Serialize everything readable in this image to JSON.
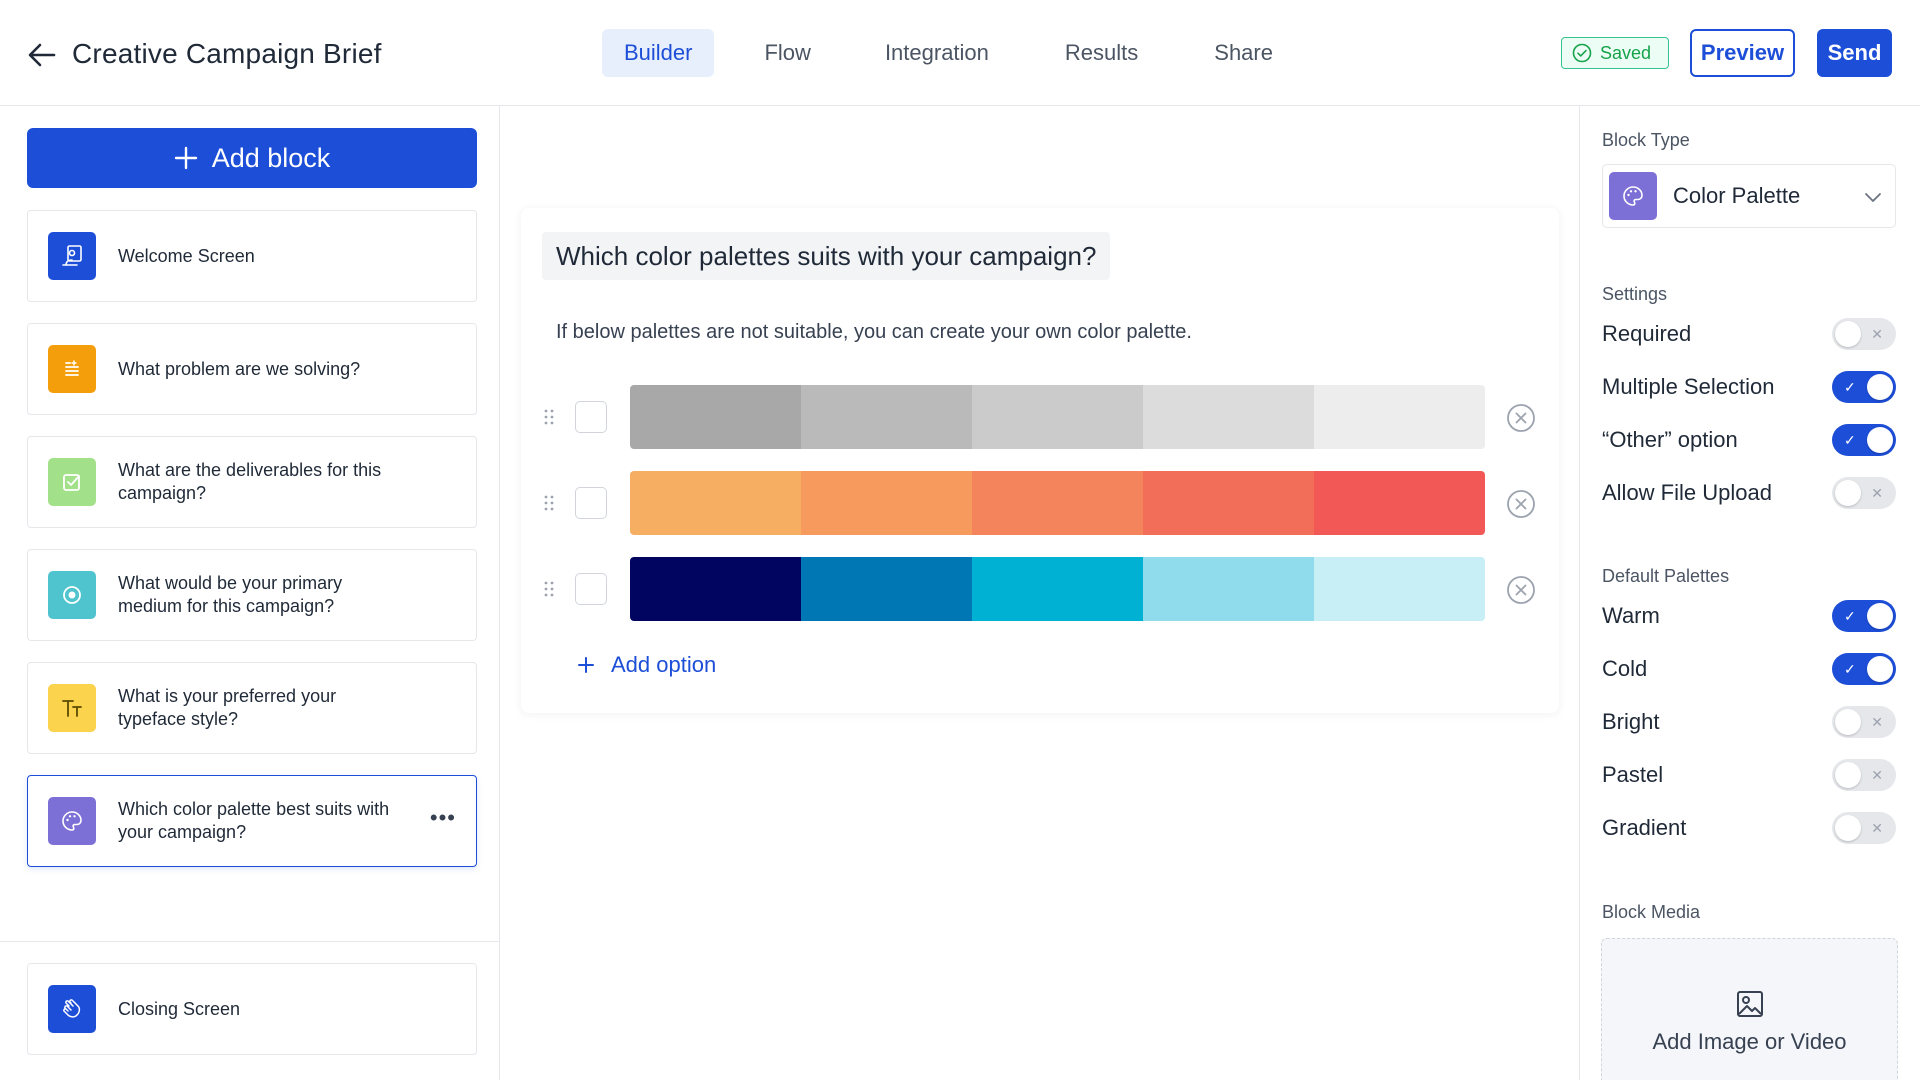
{
  "header": {
    "title": "Creative Campaign Brief",
    "tabs": [
      {
        "label": "Builder",
        "active": true
      },
      {
        "label": "Flow",
        "active": false
      },
      {
        "label": "Integration",
        "active": false
      },
      {
        "label": "Results",
        "active": false
      },
      {
        "label": "Share",
        "active": false
      }
    ],
    "saved_label": "Saved",
    "preview_label": "Preview",
    "send_label": "Send"
  },
  "sidebar": {
    "add_block_label": "Add block",
    "blocks": [
      {
        "label": "Welcome Screen",
        "icon": "welcome-icon",
        "color": "#1d4ed8"
      },
      {
        "label": "What problem are we solving?",
        "icon": "text-lines-icon",
        "color": "#f59e0b"
      },
      {
        "label": "What are the deliverables for this campaign?",
        "icon": "checkbox-icon",
        "color": "#a3e08a"
      },
      {
        "label": "What would be your primary medium for this campaign?",
        "icon": "radio-icon",
        "color": "#4fc4cf"
      },
      {
        "label": "What is your preferred your typeface style?",
        "icon": "typeface-icon",
        "color": "#fcd34d"
      },
      {
        "label": "Which color palette best suits with your campaign?",
        "icon": "palette-icon",
        "color": "#7c6fd6"
      }
    ],
    "closing": {
      "label": "Closing Screen",
      "icon": "wave-hand-icon",
      "color": "#1d4ed8"
    }
  },
  "question": {
    "title": "Which color palettes suits with your campaign?",
    "description": "If below palettes are not suitable, you can create your own color palette.",
    "palettes": [
      {
        "name": "gray",
        "colors": [
          "#a8a8a8",
          "#bababa",
          "#cbcbcb",
          "#dcdcdc",
          "#ededed"
        ]
      },
      {
        "name": "warm",
        "colors": [
          "#f6ae62",
          "#f69a5e",
          "#f4845b",
          "#f36e58",
          "#f25855"
        ]
      },
      {
        "name": "cold",
        "colors": [
          "#020560",
          "#0077b5",
          "#00b1d4",
          "#90dcec",
          "#c8eef6"
        ]
      }
    ],
    "add_option_label": "Add option"
  },
  "panel": {
    "block_type_label": "Block Type",
    "block_type_value": "Color Palette",
    "settings_label": "Settings",
    "settings": [
      {
        "label": "Required",
        "on": false
      },
      {
        "label": "Multiple Selection",
        "on": true
      },
      {
        "label": "“Other” option",
        "on": true
      },
      {
        "label": "Allow File Upload",
        "on": false
      }
    ],
    "default_palettes_label": "Default Palettes",
    "default_palettes": [
      {
        "label": "Warm",
        "on": true
      },
      {
        "label": "Cold",
        "on": true
      },
      {
        "label": "Bright",
        "on": false
      },
      {
        "label": "Pastel",
        "on": false
      },
      {
        "label": "Gradient",
        "on": false
      }
    ],
    "block_media_label": "Block Media",
    "add_media_label": "Add Image or Video"
  },
  "colors": {
    "accent": "#1d4ed8",
    "saved_green": "#16a34a"
  }
}
